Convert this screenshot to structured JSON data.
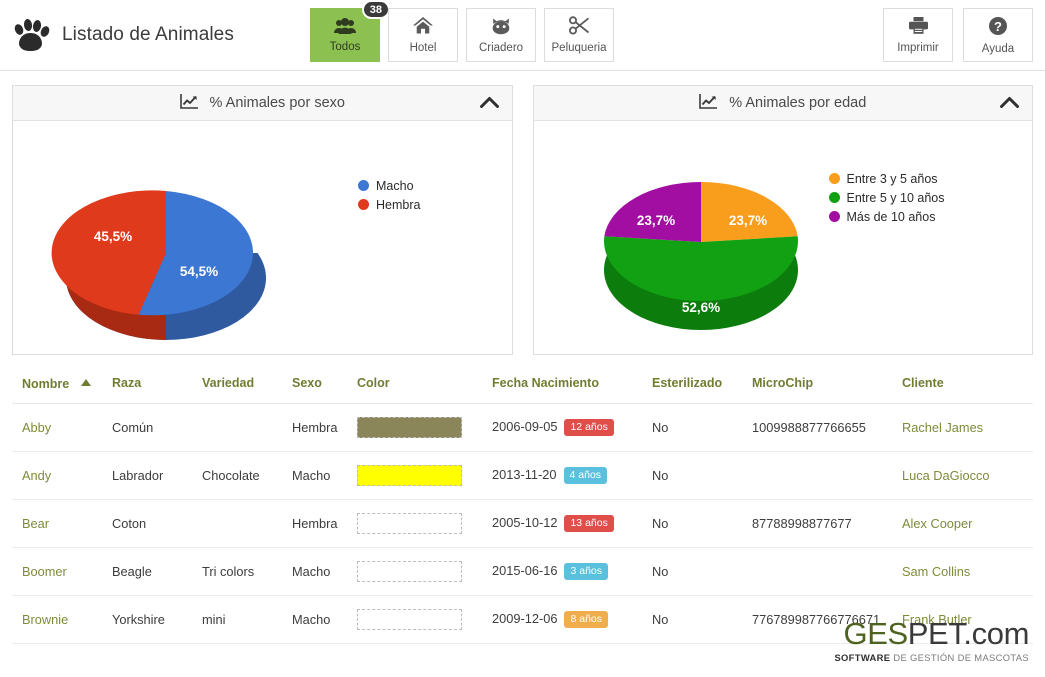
{
  "header": {
    "logo_icon": "paw-icon",
    "title": "Listado de Animales",
    "tabs": [
      {
        "label": "Todos",
        "icon": "group-users-icon",
        "badge": "38",
        "active": true
      },
      {
        "label": "Hotel",
        "icon": "home-icon",
        "badge": "",
        "active": false
      },
      {
        "label": "Criadero",
        "icon": "cat-face-icon",
        "badge": "",
        "active": false
      },
      {
        "label": "Peluqueria",
        "icon": "scissors-icon",
        "badge": "",
        "active": false
      }
    ],
    "actions": [
      {
        "label": "Imprimir",
        "icon": "printer-icon"
      },
      {
        "label": "Ayuda",
        "icon": "question-circle-icon"
      }
    ],
    "active_tab_color": "#8cc152",
    "badge_color": "#3a3a3a"
  },
  "panels": [
    {
      "title": "% Animales por sexo",
      "icon": "line-chart-icon",
      "collapse_icon": "chevron-up-icon"
    },
    {
      "title": "% Animales por edad",
      "icon": "line-chart-icon",
      "collapse_icon": "chevron-up-icon"
    }
  ],
  "chart_data": [
    {
      "type": "pie",
      "title": "% Animales por sexo",
      "categories": [
        "Macho",
        "Hembra"
      ],
      "values": [
        54.5,
        45.5
      ],
      "labels": [
        "54,5%",
        "45,5%"
      ],
      "colors": [
        "#3c77d4",
        "#e03a1d"
      ],
      "legend_position": "right",
      "three_d": true
    },
    {
      "type": "pie",
      "title": "% Animales por edad",
      "categories": [
        "Entre 3 y 5 años",
        "Entre 5 y 10  años",
        "Más de 10 años"
      ],
      "values": [
        23.7,
        52.6,
        23.7
      ],
      "labels": [
        "23,7%",
        "52,6%",
        "23,7%"
      ],
      "colors": [
        "#f99d1c",
        "#12a112",
        "#a20ea2"
      ],
      "legend_position": "right",
      "three_d": true
    }
  ],
  "table": {
    "columns": [
      {
        "label": "Nombre",
        "sorted": true,
        "sort_icon": "caret-up-icon"
      },
      {
        "label": "Raza",
        "sorted": false
      },
      {
        "label": "Variedad",
        "sorted": false
      },
      {
        "label": "Sexo",
        "sorted": false
      },
      {
        "label": "Color",
        "sorted": false
      },
      {
        "label": "Fecha Nacimiento",
        "sorted": false
      },
      {
        "label": "Esterilizado",
        "sorted": false
      },
      {
        "label": "MicroChip",
        "sorted": false
      },
      {
        "label": "Cliente",
        "sorted": false
      }
    ],
    "rows": [
      {
        "nombre": "Abby",
        "raza": "Común",
        "variedad": "",
        "sexo": "Hembra",
        "color_hex": "#8b8659",
        "fecha": "2006-09-05",
        "edad_badge": "12 años",
        "edad_badge_color": "#df4e49",
        "esterilizado": "No",
        "microchip": "1009988877766655",
        "cliente": "Rachel James"
      },
      {
        "nombre": "Andy",
        "raza": "Labrador",
        "variedad": "Chocolate",
        "sexo": "Macho",
        "color_hex": "#ffff00",
        "fecha": "2013-11-20",
        "edad_badge": "4 años",
        "edad_badge_color": "#5bc0de",
        "esterilizado": "No",
        "microchip": "",
        "cliente": "Luca DaGiocco"
      },
      {
        "nombre": "Bear",
        "raza": "Coton",
        "variedad": "",
        "sexo": "Hembra",
        "color_hex": "",
        "fecha": "2005-10-12",
        "edad_badge": "13 años",
        "edad_badge_color": "#df4e49",
        "esterilizado": "No",
        "microchip": "87788998877677",
        "cliente": "Alex Cooper"
      },
      {
        "nombre": "Boomer",
        "raza": "Beagle",
        "variedad": "Tri colors",
        "sexo": "Macho",
        "color_hex": "",
        "fecha": "2015-06-16",
        "edad_badge": "3 años",
        "edad_badge_color": "#5bc0de",
        "esterilizado": "No",
        "microchip": "",
        "cliente": "Sam Collins"
      },
      {
        "nombre": "Brownie",
        "raza": "Yorkshire",
        "variedad": "mini",
        "sexo": "Macho",
        "color_hex": "",
        "fecha": "2009-12-06",
        "edad_badge": "8 años",
        "edad_badge_color": "#f0ad4e",
        "esterilizado": "No",
        "microchip": "776789987766776671",
        "cliente": "Frank Butler"
      }
    ]
  },
  "footer": {
    "logo_part1": "GES",
    "logo_part2": "PET.com",
    "tagline_strong": "SOFTWARE",
    "tagline_rest": " DE GESTIÓN DE MASCOTAS"
  }
}
